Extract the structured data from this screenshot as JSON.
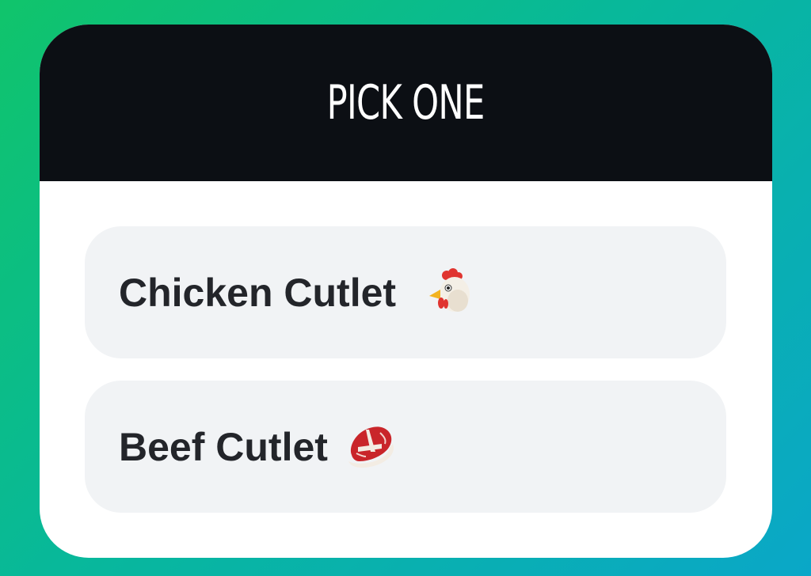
{
  "poll": {
    "title": "PICK ONE",
    "options": [
      {
        "label": "Chicken Cutlet",
        "icon": "chicken-icon"
      },
      {
        "label": "Beef Cutlet",
        "icon": "steak-icon"
      }
    ]
  },
  "colors": {
    "header_background": "#0c0f14",
    "option_background": "#f1f3f5",
    "option_text": "#23252a",
    "background_gradient_start": "#10c46b",
    "background_gradient_end": "#0aa7c8"
  }
}
